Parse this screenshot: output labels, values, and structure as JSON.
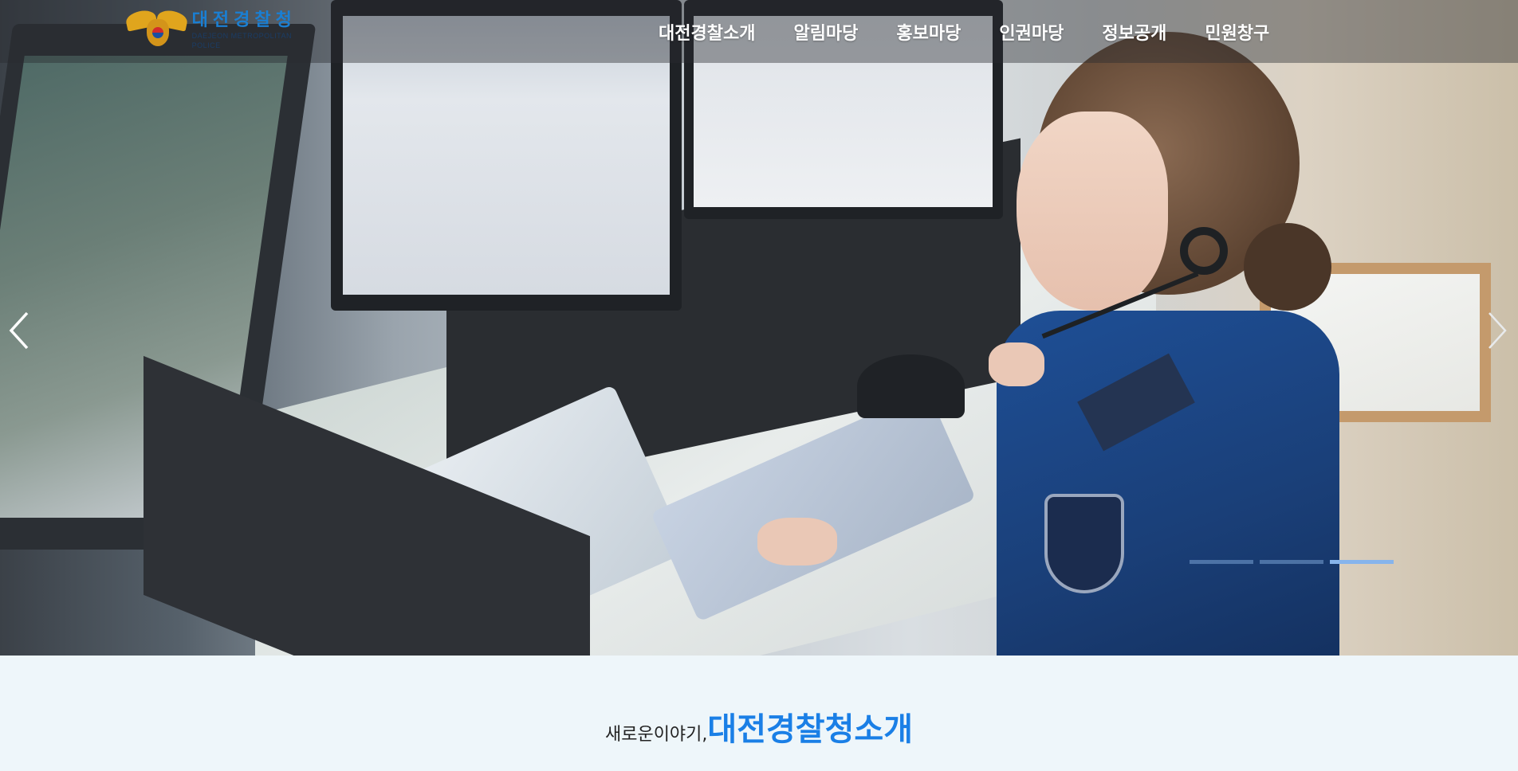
{
  "header": {
    "logo_korean": "대전경찰청",
    "logo_english": "DAEJEON METROPOLITAN POLICE"
  },
  "nav": {
    "items": [
      "대전경찰소개",
      "알림마당",
      "홍보마당",
      "인권마당",
      "정보공개",
      "민원창구"
    ]
  },
  "slider": {
    "prev_icon": "chevron-left-icon",
    "next_icon": "chevron-right-icon",
    "slide_count": 3,
    "active_slide": 3
  },
  "intro": {
    "prefix": "새로운이야기,",
    "title": "대전경찰청소개"
  },
  "colors": {
    "accent": "#1a7fe6",
    "logo_blue": "#1a7fd3",
    "indicator_active": "#86b4ec"
  }
}
